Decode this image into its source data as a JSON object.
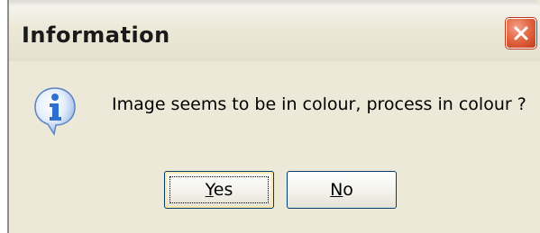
{
  "window": {
    "title": "Information"
  },
  "titlebar_controls": {
    "close_icon": "close-icon"
  },
  "content": {
    "icon": "info-icon",
    "message": "Image seems to be in colour, process in colour ?"
  },
  "buttons": {
    "yes": {
      "mnemonic": "Y",
      "rest": "es"
    },
    "no": {
      "mnemonic": "N",
      "rest": "o"
    }
  },
  "colors": {
    "dialog_face": "#ece9d8",
    "close_button": "#e36a45",
    "info_icon_blue": "#2e6fd0",
    "default_button_border": "#003c74"
  }
}
